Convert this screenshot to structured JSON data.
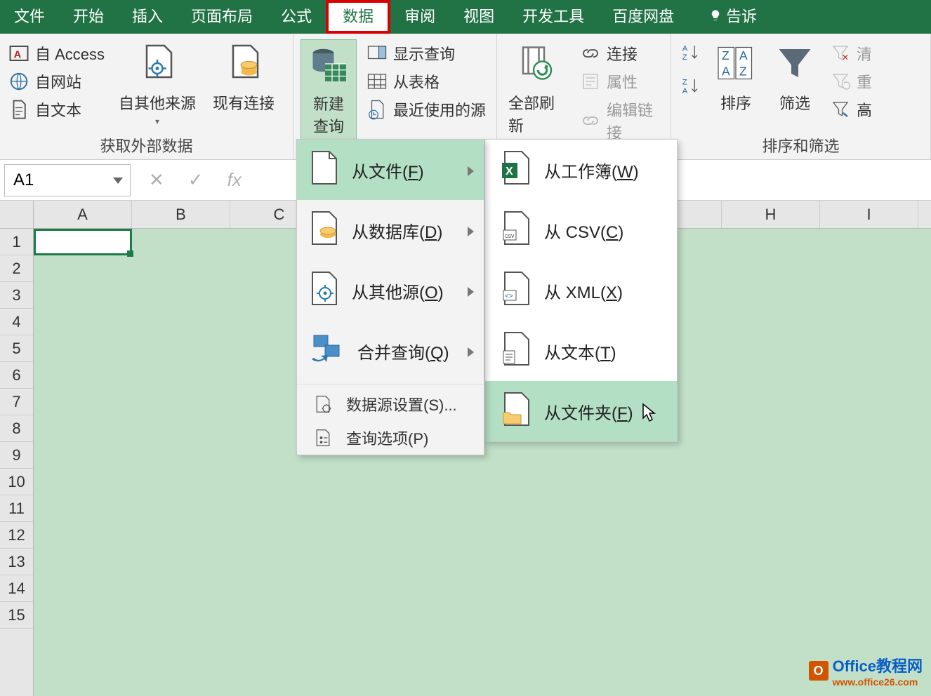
{
  "tabs": {
    "file": "文件",
    "home": "开始",
    "insert": "插入",
    "pagelayout": "页面布局",
    "formulas": "公式",
    "data": "数据",
    "review": "审阅",
    "view": "视图",
    "developer": "开发工具",
    "baidu": "百度网盘",
    "tellme": "告诉"
  },
  "ribbon": {
    "from_access": "自 Access",
    "from_web": "自网站",
    "from_text": "自文本",
    "other_sources": "自其他来源",
    "existing_conn": "现有连接",
    "new_query": "新建\n查询",
    "show_queries": "显示查询",
    "from_table": "从表格",
    "recent_sources": "最近使用的源",
    "refresh_all": "全部刷新",
    "connections": "连接",
    "properties": "属性",
    "edit_links": "编辑链接",
    "sort": "排序",
    "filter": "筛选",
    "clear": "清",
    "reapply": "重",
    "advanced": "高",
    "group1": "获取外部数据",
    "group4": "排序和筛选"
  },
  "namebox": "A1",
  "fx": {
    "cancel": "✕",
    "enter": "✓",
    "fx": "fx"
  },
  "cols": [
    "A",
    "B",
    "C",
    "",
    "",
    "",
    "",
    "H",
    "I"
  ],
  "rows": [
    "1",
    "2",
    "3",
    "4",
    "5",
    "6",
    "7",
    "8",
    "9",
    "10",
    "11",
    "12",
    "13",
    "14",
    "15"
  ],
  "menu1": {
    "from_file": "从文件(F)",
    "from_db": "从数据库(D)",
    "from_other": "从其他源(O)",
    "combine": "合并查询(Q)",
    "ds_settings": "数据源设置(S)...",
    "query_opts": "查询选项(P)"
  },
  "menu2": {
    "from_workbook": "从工作簿(W)",
    "from_csv": "从 CSV(C)",
    "from_xml": "从 XML(X)",
    "from_txt": "从文本(T)",
    "from_folder": "从文件夹(F)"
  },
  "watermark": {
    "brand": "Office教程网",
    "url": "www.office26.com"
  }
}
